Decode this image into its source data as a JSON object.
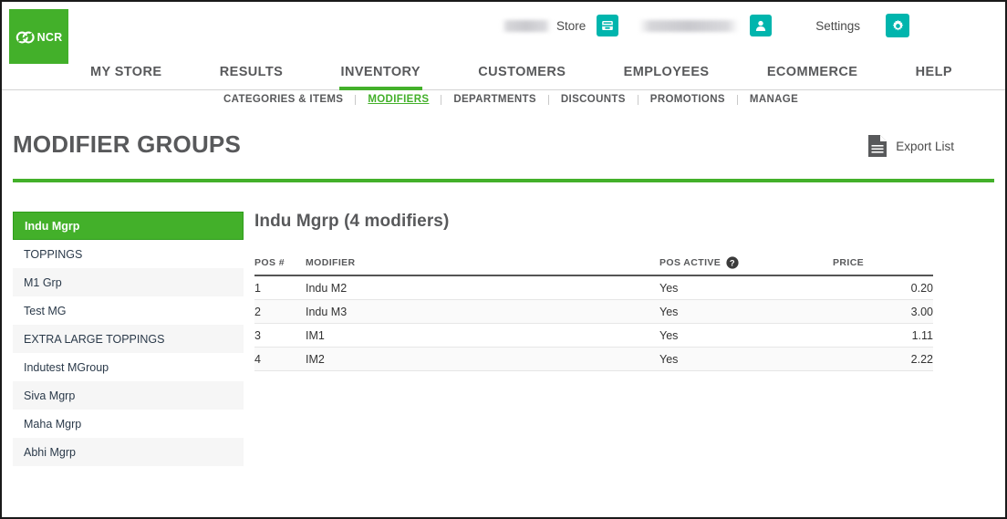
{
  "brand": {
    "logo_text": "NCR",
    "logo_icon": "ncr-rings-icon",
    "green": "#43b02a",
    "teal": "#00b5ad"
  },
  "header": {
    "store_label": "Store",
    "store_name_redacted": "",
    "user_name_redacted": "",
    "settings_label": "Settings",
    "store_icon": "store-register-icon",
    "user_icon": "user-profile-icon",
    "gear_icon": "gear-icon"
  },
  "mainnav": {
    "items": [
      {
        "label": "MY STORE",
        "active": false
      },
      {
        "label": "RESULTS",
        "active": false
      },
      {
        "label": "INVENTORY",
        "active": true
      },
      {
        "label": "CUSTOMERS",
        "active": false
      },
      {
        "label": "EMPLOYEES",
        "active": false
      },
      {
        "label": "ECOMMERCE",
        "active": false
      },
      {
        "label": "HELP",
        "active": false
      }
    ]
  },
  "subnav": {
    "items": [
      {
        "label": "CATEGORIES & ITEMS",
        "active": false
      },
      {
        "label": "MODIFIERS",
        "active": true
      },
      {
        "label": "DEPARTMENTS",
        "active": false
      },
      {
        "label": "DISCOUNTS",
        "active": false
      },
      {
        "label": "PROMOTIONS",
        "active": false
      },
      {
        "label": "MANAGE",
        "active": false
      }
    ]
  },
  "page": {
    "title": "MODIFIER GROUPS",
    "export_label": "Export List",
    "export_icon": "document-export-icon"
  },
  "sidebar": {
    "items": [
      {
        "label": "Indu Mgrp",
        "selected": true
      },
      {
        "label": "TOPPINGS",
        "selected": false
      },
      {
        "label": "M1 Grp",
        "selected": false
      },
      {
        "label": "Test MG",
        "selected": false
      },
      {
        "label": "EXTRA LARGE TOPPINGS",
        "selected": false
      },
      {
        "label": "Indutest MGroup",
        "selected": false
      },
      {
        "label": "Siva Mgrp",
        "selected": false
      },
      {
        "label": "Maha Mgrp",
        "selected": false
      },
      {
        "label": "Abhi Mgrp",
        "selected": false
      }
    ]
  },
  "panel": {
    "title": "Indu Mgrp (4 modifiers)",
    "help_icon": "question-mark-help-icon",
    "columns": {
      "pos": "POS #",
      "modifier": "MODIFIER",
      "pos_active": "POS ACTIVE",
      "price": "PRICE"
    },
    "rows": [
      {
        "pos": "1",
        "modifier": "Indu M2",
        "pos_active": "Yes",
        "price": "0.20"
      },
      {
        "pos": "2",
        "modifier": "Indu M3",
        "pos_active": "Yes",
        "price": "3.00"
      },
      {
        "pos": "3",
        "modifier": "IM1",
        "pos_active": "Yes",
        "price": "1.11"
      },
      {
        "pos": "4",
        "modifier": "IM2",
        "pos_active": "Yes",
        "price": "2.22"
      }
    ]
  }
}
